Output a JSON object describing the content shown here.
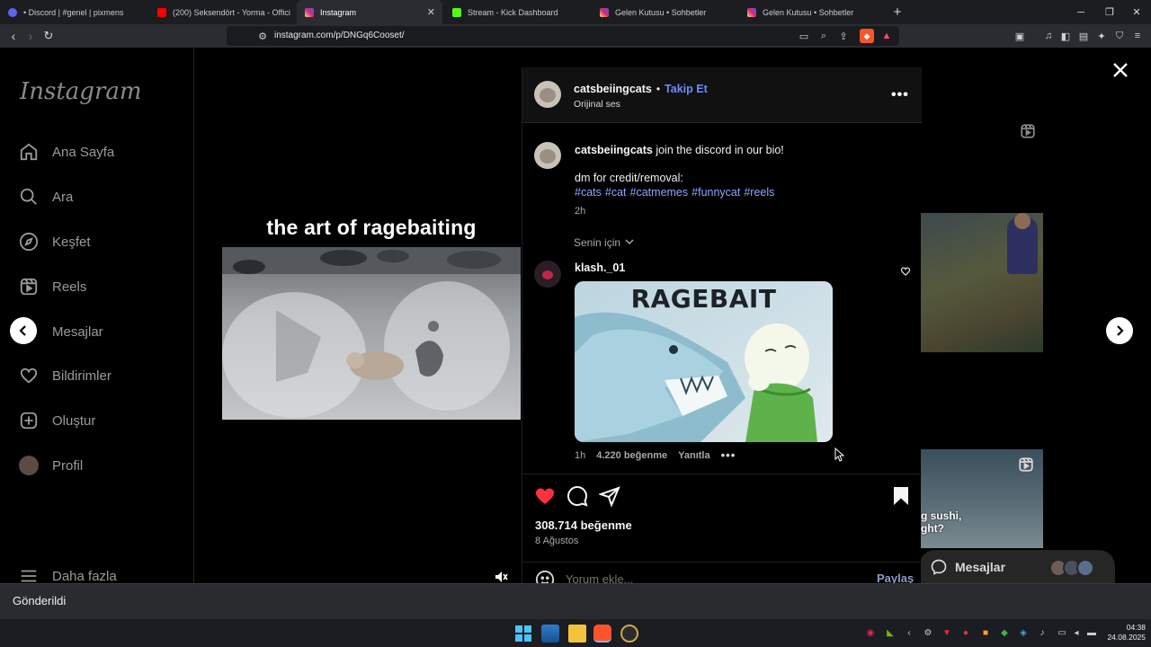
{
  "browser": {
    "tabs": [
      {
        "title": "• Discord | #genel | pixmens",
        "color": "#5865f2"
      },
      {
        "title": "(200) Seksendört - Yorma - Offici",
        "color": "#ff0000"
      },
      {
        "title": "Instagram",
        "color": "#d6249f",
        "active": true
      },
      {
        "title": "Stream - Kick Dashboard",
        "color": "#53fc18"
      },
      {
        "title": "Gelen Kutusu • Sohbetler",
        "color": "#d6249f"
      },
      {
        "title": "Gelen Kutusu • Sohbetler",
        "color": "#d6249f"
      }
    ],
    "new_tab": "+",
    "url": "instagram.com/p/DNGq6Cooset/"
  },
  "sidebar": {
    "logo": "Instagram",
    "items": [
      {
        "label": "Ana Sayfa",
        "icon": "home-icon"
      },
      {
        "label": "Ara",
        "icon": "search-icon"
      },
      {
        "label": "Keşfet",
        "icon": "compass-icon"
      },
      {
        "label": "Reels",
        "icon": "reels-icon"
      },
      {
        "label": "Mesajlar",
        "icon": "messenger-icon"
      },
      {
        "label": "Bildirimler",
        "icon": "heart-icon"
      },
      {
        "label": "Oluştur",
        "icon": "plus-icon"
      },
      {
        "label": "Profil",
        "icon": "avatar"
      }
    ],
    "more": "Daha fazla"
  },
  "post": {
    "overlay_caption": "the art of ragebaiting",
    "author": "catsbeiingcats",
    "follow": "Takip Et",
    "audio": "Orijinal ses",
    "caption_user": "catsbeiingcats",
    "caption_line1": "join the discord in our bio!",
    "caption_line2": "dm for credit/removal:",
    "hashtags": [
      "#cats",
      "#cat",
      "#catmemes",
      "#funnycat",
      "#reels"
    ],
    "caption_time": "2h",
    "sort_label": "Senin için",
    "comment": {
      "user": "klash._01",
      "image_text": "RAGEBAIT",
      "time": "1h",
      "likes": "4.220 beğenme",
      "reply": "Yanıtla"
    },
    "likes": "308.714 beğenme",
    "date": "8 Ağustos",
    "comment_placeholder": "Yorum ekle...",
    "share": "Paylaş"
  },
  "messages_dock": "Mesajlar",
  "bg_tile_text": "g sushi,\nght?",
  "toast": "Gönderildi",
  "clock": {
    "time": "04:38",
    "date": "24.08.2025"
  }
}
